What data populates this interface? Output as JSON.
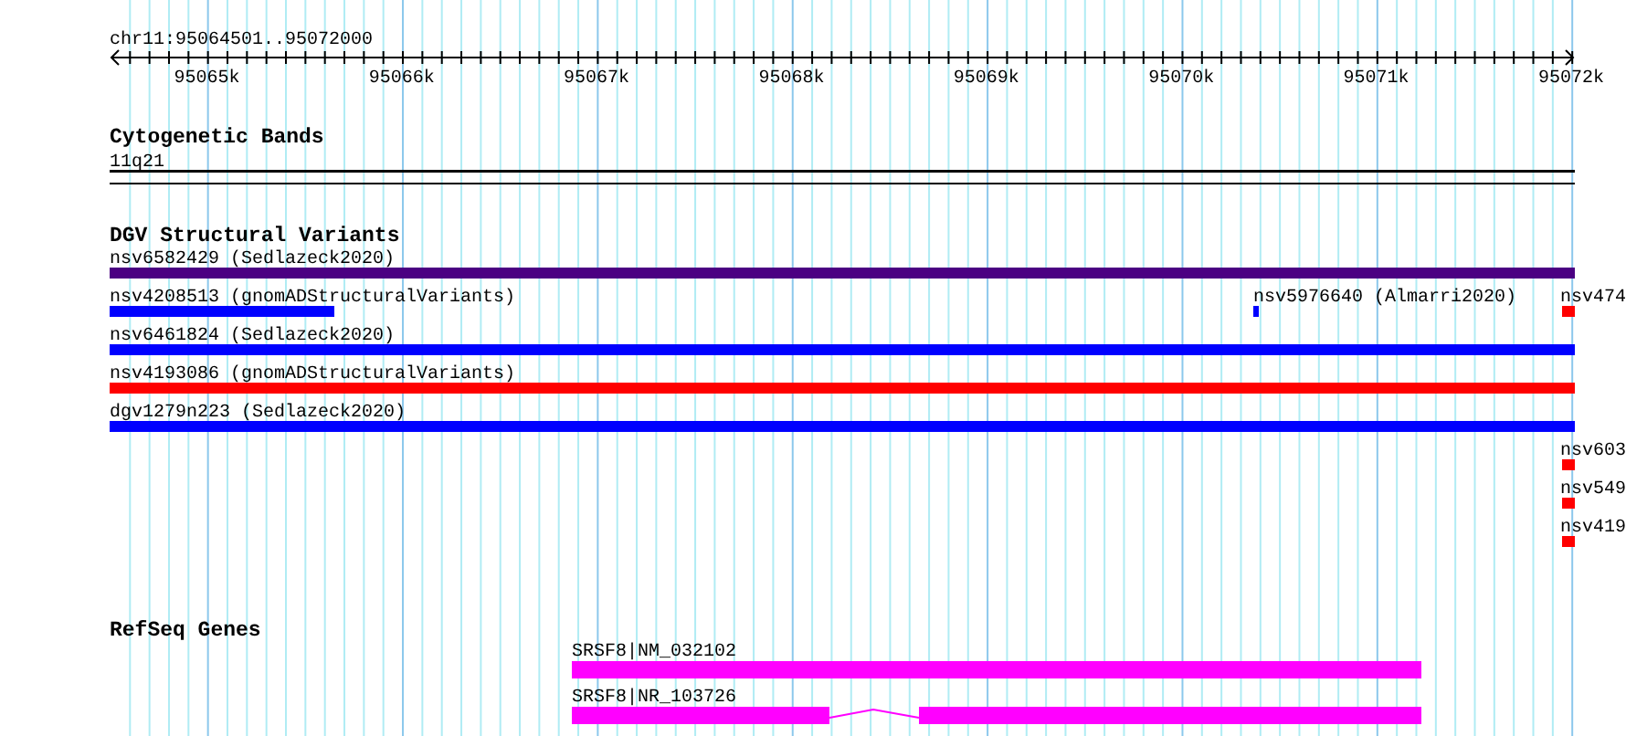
{
  "ruler": {
    "region": "chr11:95064501..95072000",
    "ticks": [
      "95065k",
      "95066k",
      "95067k",
      "95068k",
      "95069k",
      "95070k",
      "95071k",
      "95072k"
    ]
  },
  "tracks": [
    {
      "title": "Cytogenetic Bands",
      "kind": "bands",
      "features": [
        {
          "label": "11q21"
        }
      ]
    },
    {
      "title": "DGV Structural Variants",
      "kind": "variants",
      "features": [
        {
          "label": "nsv6582429 (Sedlazeck2020)",
          "color": "#4b0082"
        },
        {
          "label": "nsv4208513 (gnomADStructuralVariants)",
          "color": "#0000ff"
        },
        {
          "label": "nsv5976640 (Almarri2020)",
          "color": "#0000ff"
        },
        {
          "label": "nsv474",
          "color": "#ff0000"
        },
        {
          "label": "nsv6461824 (Sedlazeck2020)",
          "color": "#0000ff"
        },
        {
          "label": "nsv4193086 (gnomADStructuralVariants)",
          "color": "#ff0000"
        },
        {
          "label": "dgv1279n223 (Sedlazeck2020)",
          "color": "#0000ff"
        },
        {
          "label": "nsv603",
          "color": "#ff0000"
        },
        {
          "label": "nsv549",
          "color": "#ff0000"
        },
        {
          "label": "nsv419",
          "color": "#ff0000"
        }
      ]
    },
    {
      "title": "RefSeq Genes",
      "kind": "genes",
      "features": [
        {
          "label": "SRSF8|NM_032102"
        },
        {
          "label": "SRSF8|NR_103726"
        }
      ]
    }
  ]
}
